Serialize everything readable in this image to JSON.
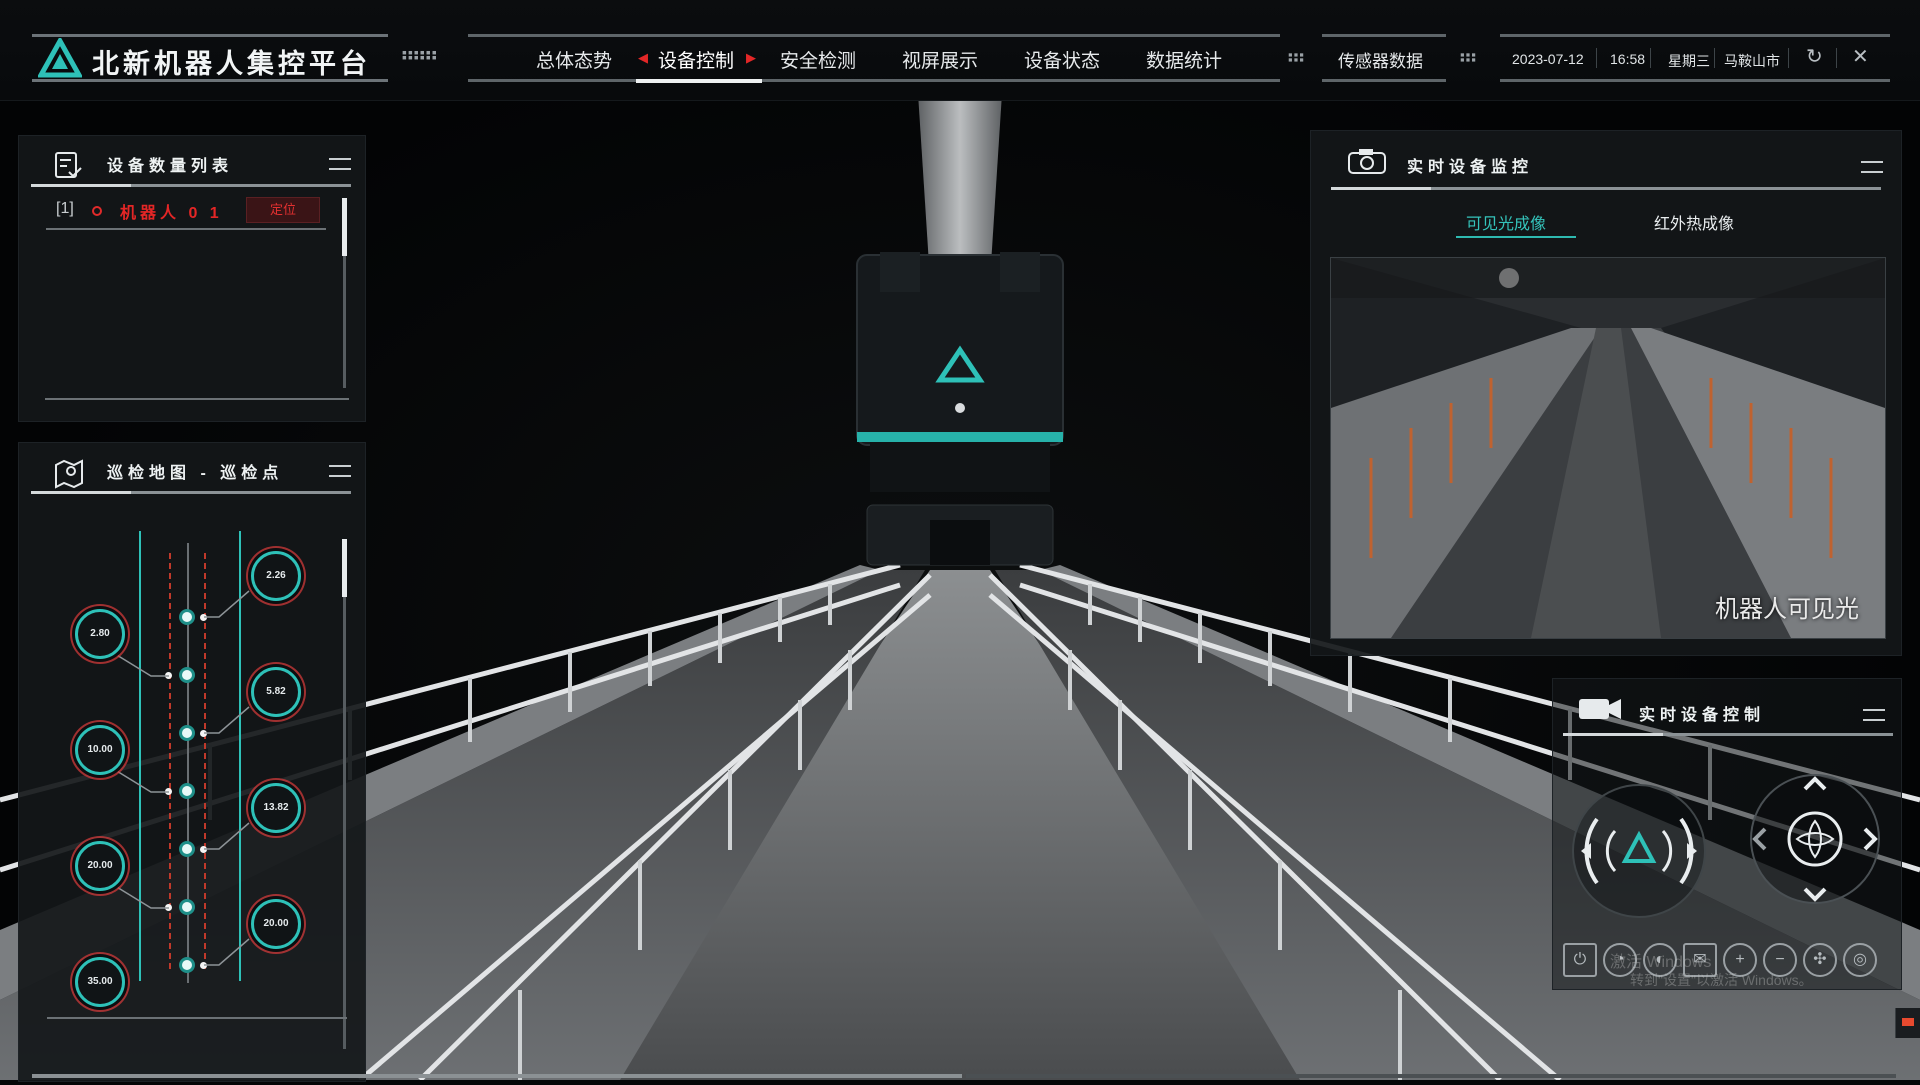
{
  "app": {
    "title": "北新机器人集控平台"
  },
  "nav": {
    "items": [
      "总体态势",
      "设备控制",
      "安全检测",
      "视屏展示",
      "设备状态",
      "数据统计"
    ],
    "active": "设备控制",
    "sensor": "传感器数据"
  },
  "info": {
    "date": "2023-07-12",
    "time": "16:58",
    "weekday": "星期三",
    "city": "马鞍山市"
  },
  "device_list": {
    "title": "设备数量列表",
    "rows": [
      {
        "index": "1",
        "name": "机器人 0 1",
        "action": "定位"
      }
    ]
  },
  "patrol": {
    "title": "巡检地图 - 巡检点",
    "left_points": [
      "2.80",
      "10.00",
      "20.00",
      "35.00"
    ],
    "right_points": [
      "2.26",
      "5.82",
      "13.82",
      "20.00"
    ]
  },
  "monitor": {
    "title": "实时设备监控",
    "tabs": [
      "可见光成像",
      "红外热成像"
    ],
    "active_tab": "可见光成像",
    "video_label": "机器人可见光"
  },
  "control": {
    "title": "实时设备控制",
    "toolbar_icons": [
      "charge-icon",
      "speed-icon",
      "wiper-icon",
      "light-icon",
      "zoom-in-icon",
      "zoom-out-icon",
      "focus-icon",
      "record-icon"
    ]
  },
  "watermark": {
    "line1": "激活 Windows",
    "line2": "转到\"设置\"以激活 Windows。"
  },
  "colors": {
    "accent": "#2ec1b8",
    "alert": "#e42626",
    "panel": "#141719"
  }
}
